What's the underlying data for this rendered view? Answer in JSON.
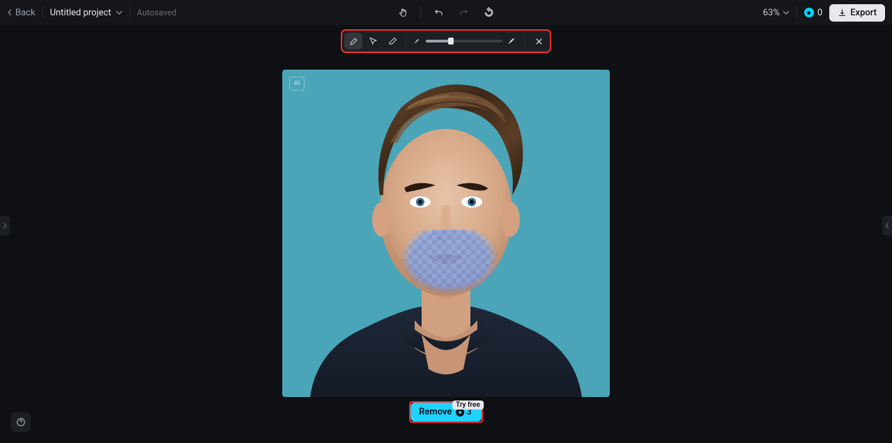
{
  "topbar": {
    "back_label": "Back",
    "project_title": "Untitled project",
    "autosaved_label": "Autosaved",
    "zoom_label": "63%",
    "credits_count": "0",
    "export_label": "Export"
  },
  "toolbar": {
    "slider_value": 33
  },
  "canvas": {
    "ai_badge": "AI"
  },
  "remove": {
    "label": "Remove",
    "credits_cost": "3",
    "try_free_label": "Try free"
  }
}
